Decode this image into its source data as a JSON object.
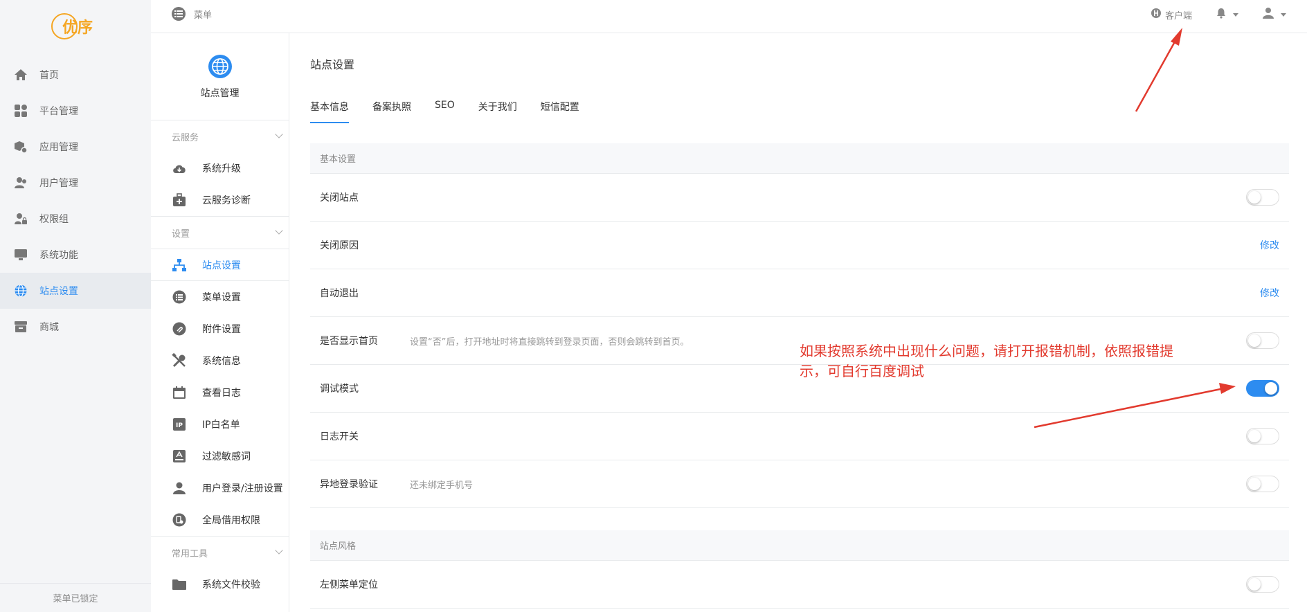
{
  "brand": {
    "logo_text": "优序",
    "color": "#f5a623"
  },
  "accent": "#2d8cf0",
  "left_nav": {
    "items": [
      {
        "label": "首页",
        "icon": "home-icon",
        "active": false
      },
      {
        "label": "平台管理",
        "icon": "grid-icon",
        "active": false
      },
      {
        "label": "应用管理",
        "icon": "app-box-icon",
        "active": false
      },
      {
        "label": "用户管理",
        "icon": "users-icon",
        "active": false
      },
      {
        "label": "权限组",
        "icon": "user-lock-icon",
        "active": false
      },
      {
        "label": "系统功能",
        "icon": "monitor-icon",
        "active": false
      },
      {
        "label": "站点设置",
        "icon": "globe-icon",
        "active": true
      },
      {
        "label": "商城",
        "icon": "store-icon",
        "active": false
      }
    ],
    "lock_label": "菜单已锁定"
  },
  "header": {
    "menu_label": "菜单",
    "client_label": "客户端"
  },
  "sub_nav": {
    "title": "站点管理",
    "sections": [
      {
        "title": "云服务",
        "items": [
          {
            "label": "系统升级",
            "icon": "cloud-download-icon"
          },
          {
            "label": "云服务诊断",
            "icon": "medkit-icon"
          }
        ]
      },
      {
        "title": "设置",
        "items": [
          {
            "label": "站点设置",
            "icon": "sitemap-icon",
            "active": true
          },
          {
            "label": "菜单设置",
            "icon": "list-icon"
          },
          {
            "label": "附件设置",
            "icon": "attachment-icon"
          },
          {
            "label": "系统信息",
            "icon": "tools-icon"
          },
          {
            "label": "查看日志",
            "icon": "calendar-icon"
          },
          {
            "label": "IP白名单",
            "icon": "ip-icon"
          },
          {
            "label": "过滤敏感词",
            "icon": "filter-text-icon"
          },
          {
            "label": "用户登录/注册设置",
            "icon": "user-icon"
          },
          {
            "label": "全局借用权限",
            "icon": "borrow-icon"
          }
        ]
      },
      {
        "title": "常用工具",
        "items": [
          {
            "label": "系统文件校验",
            "icon": "folder-icon"
          }
        ]
      }
    ]
  },
  "main": {
    "title": "站点设置",
    "tabs": [
      "基本信息",
      "备案执照",
      "SEO",
      "关于我们",
      "短信配置"
    ],
    "section_basic": "基本设置",
    "rows": [
      {
        "label": "关闭站点",
        "control": "toggle",
        "on": false
      },
      {
        "label": "关闭原因",
        "control": "link",
        "link": "修改"
      },
      {
        "label": "自动退出",
        "control": "link",
        "link": "修改"
      },
      {
        "label": "是否显示首页",
        "desc": "设置“否”后，打开地址时将直接跳转到登录页面，否则会跳转到首页。",
        "control": "toggle",
        "on": false
      },
      {
        "label": "调试模式",
        "control": "toggle",
        "on": true
      },
      {
        "label": "日志开关",
        "control": "toggle",
        "on": false
      },
      {
        "label": "异地登录验证",
        "desc": "还未绑定手机号",
        "control": "toggle",
        "on": false
      }
    ],
    "section_style": "站点风格",
    "style_rows": [
      {
        "label": "左侧菜单定位",
        "control": "toggle",
        "on": false
      }
    ]
  },
  "annotation": {
    "text": "如果按照系统中出现什么问题，请打开报错机制，依照报错提示，可自行百度调试",
    "color": "#e23a2e"
  }
}
